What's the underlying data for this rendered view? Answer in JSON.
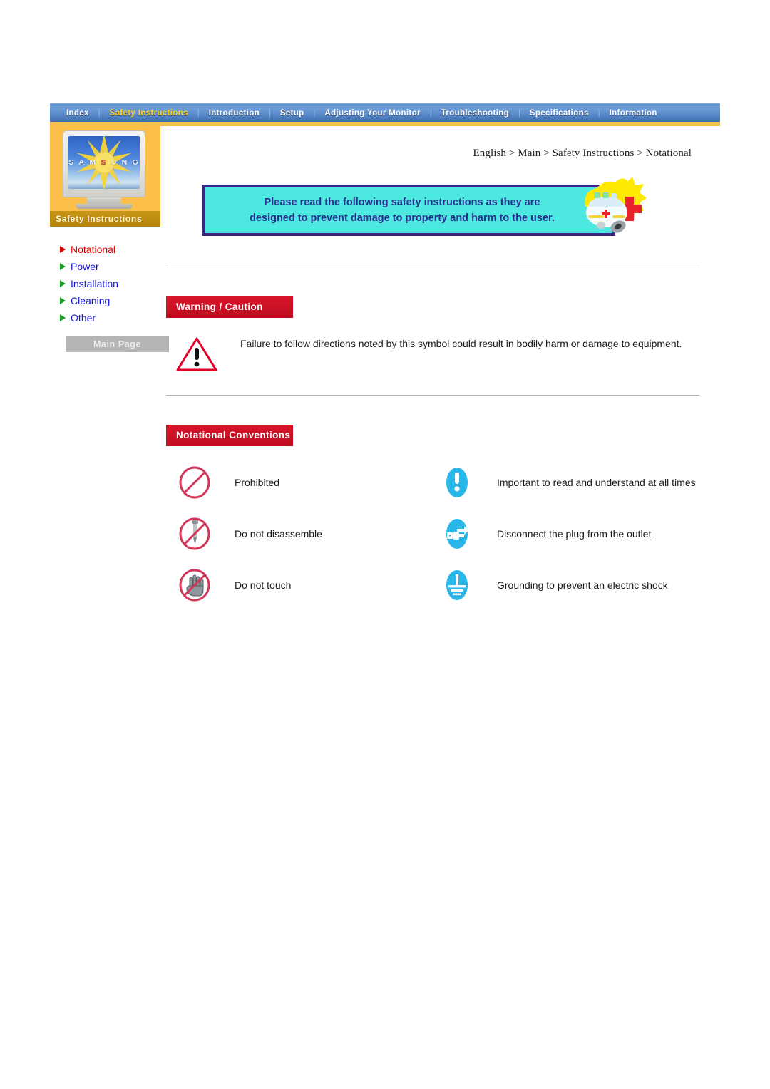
{
  "nav": {
    "items": [
      {
        "label": "Index",
        "active": false
      },
      {
        "label": "Safety Instructions",
        "active": true
      },
      {
        "label": "Introduction",
        "active": false
      },
      {
        "label": "Setup",
        "active": false
      },
      {
        "label": "Adjusting Your Monitor",
        "active": false
      },
      {
        "label": "Troubleshooting",
        "active": false
      },
      {
        "label": "Specifications",
        "active": false
      },
      {
        "label": "Information",
        "active": false
      }
    ],
    "separator": "|"
  },
  "sidebar": {
    "brand_text": "SAMSUNG",
    "brand_highlight_letter": "S",
    "section_title": "Safety Instructions",
    "items": [
      {
        "label": "Notational",
        "current": true
      },
      {
        "label": "Power",
        "current": false
      },
      {
        "label": "Installation",
        "current": false
      },
      {
        "label": "Cleaning",
        "current": false
      },
      {
        "label": "Other",
        "current": false
      }
    ],
    "main_page_button": "Main Page"
  },
  "content": {
    "breadcrumb": "English > Main > Safety Instructions > Notational",
    "banner": {
      "line1": "Please read the following safety instructions as they are",
      "line2": "designed to prevent damage to property and harm to the user.",
      "icon": "ambulance-icon"
    },
    "warning_section": {
      "heading": "Warning / Caution",
      "icon": "warning-triangle-icon",
      "text": "Failure to follow directions noted by this symbol could result in bodily harm or damage to equipment."
    },
    "notational_section": {
      "heading": "Notational Conventions",
      "rows": [
        {
          "left_icon": "prohibited-icon",
          "left_label": "Prohibited",
          "right_icon": "important-exclamation-icon",
          "right_label": "Important to read and understand at all times"
        },
        {
          "left_icon": "do-not-disassemble-icon",
          "left_label": "Do not disassemble",
          "right_icon": "disconnect-plug-icon",
          "right_label": "Disconnect the plug from the outlet"
        },
        {
          "left_icon": "do-not-touch-icon",
          "left_label": "Do not touch",
          "right_icon": "grounding-icon",
          "right_label": "Grounding to prevent an electric shock"
        }
      ]
    }
  },
  "colors": {
    "nav_blue": "#5a8fd0",
    "nav_active_yellow": "#ffd21e",
    "sidebar_gold": "#fcbf49",
    "section_red": "#cf1224",
    "link_blue": "#1515d8",
    "current_red": "#e00000",
    "arrow_green": "#1e9a28",
    "banner_cyan": "#4de8e0",
    "banner_border": "#3b2683",
    "icon_cyan": "#29b6e8",
    "prohibit_red": "#d4365a"
  }
}
